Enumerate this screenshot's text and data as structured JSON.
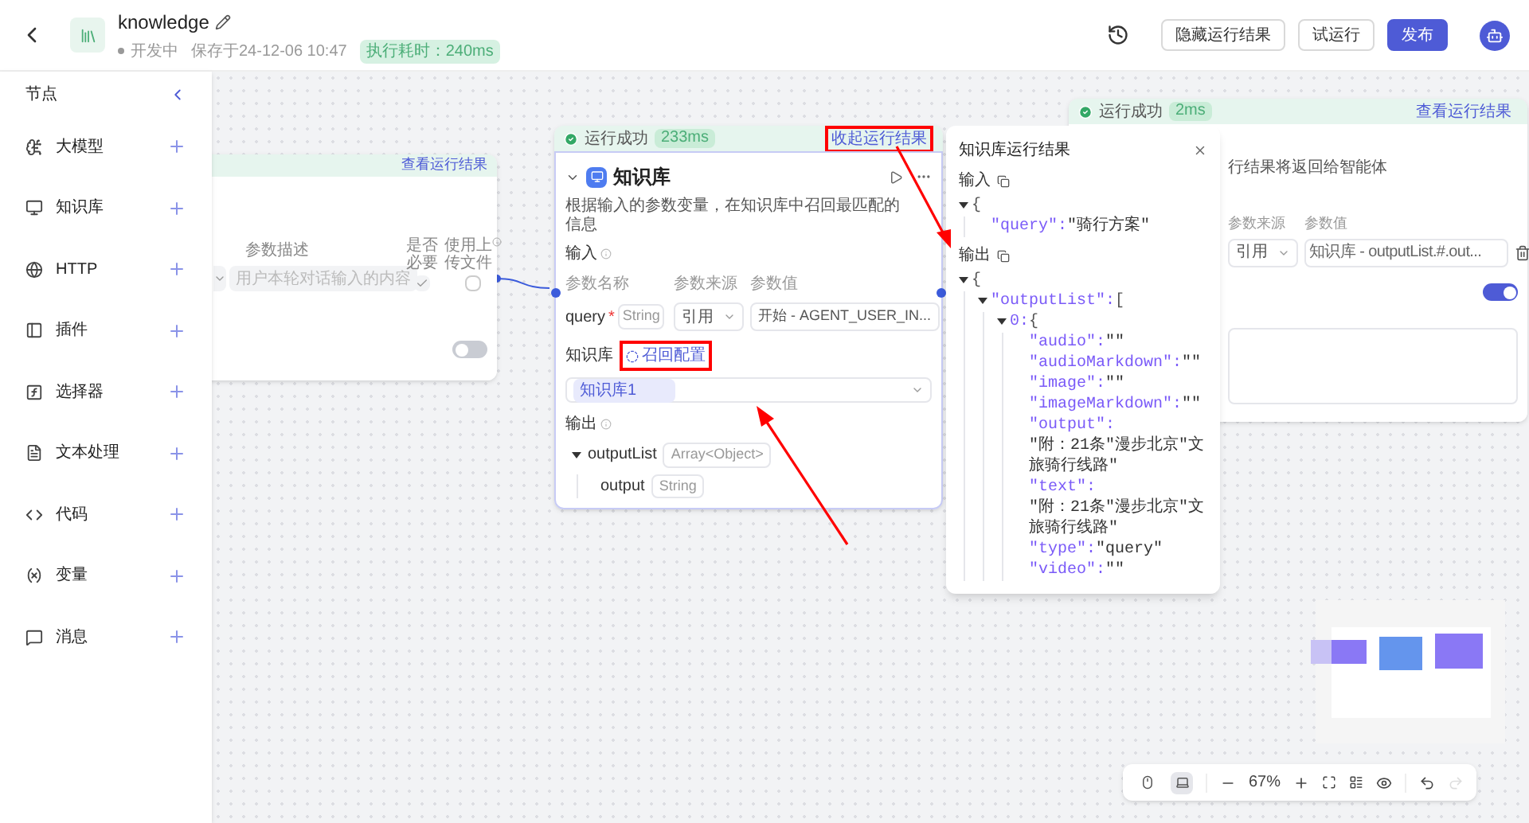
{
  "header": {
    "title": "knowledge",
    "status": "开发中",
    "saved": "保存于24-12-06 10:47",
    "run_time": "执行耗时：240ms",
    "buttons": [
      {
        "label": "隐藏运行结果",
        "kind": "secondary"
      },
      {
        "label": "试运行",
        "kind": "secondary"
      },
      {
        "label": "发布",
        "kind": "primary"
      }
    ]
  },
  "sidebar": {
    "title": "节点",
    "items": [
      {
        "label": "大模型"
      },
      {
        "label": "知识库"
      },
      {
        "label": "HTTP"
      },
      {
        "label": "插件"
      },
      {
        "label": "选择器"
      },
      {
        "label": "文本处理"
      },
      {
        "label": "代码"
      },
      {
        "label": "变量"
      },
      {
        "label": "消息"
      }
    ]
  },
  "start_node": {
    "result_link": "查看运行结果",
    "columns": [
      "参数描述",
      "是否必要",
      "使用上传文件"
    ],
    "placeholder": "用户本轮对话输入的内容",
    "required": true,
    "use_upload": false,
    "toggle_on": false
  },
  "knowledge_node": {
    "status": "运行成功",
    "duration": "233ms",
    "result_link": {
      "text": "收起运行结果",
      "highlighted": true
    },
    "title": "知识库",
    "description": "根据输入的参数变量，在知识库中召回最匹配的信息",
    "input_label": "输入",
    "columns": [
      "参数名称",
      "参数来源",
      "参数值"
    ],
    "param": {
      "name": "query",
      "required_mark": "*",
      "type": "String",
      "source": "引用",
      "value": "开始 - AGENT_USER_IN..."
    },
    "kb_label": "知识库",
    "recall_link": {
      "text": "召回配置",
      "highlighted": true
    },
    "kb_tag": "知识库1",
    "output_label": "输出",
    "outputs": [
      {
        "name": "outputList",
        "type": "Array<Object>",
        "expanded": true,
        "children": [
          {
            "name": "output",
            "type": "String"
          }
        ]
      }
    ]
  },
  "result_panel": {
    "title": "知识库运行结果",
    "sections": [
      {
        "label": "输入",
        "tree": [
          {
            "open": "{",
            "expanded": true,
            "children": [
              {
                "key": "\"query\":",
                "value": "\"骑行方案\""
              }
            ]
          }
        ]
      },
      {
        "label": "输出",
        "tree": [
          {
            "open": "{",
            "expanded": true,
            "children": [
              {
                "key": "\"outputList\":",
                "open": "[",
                "expanded": true,
                "children": [
                  {
                    "key": "0:",
                    "open": "{",
                    "expanded": true,
                    "children": [
                      {
                        "key": "\"audio\":",
                        "value": "\"\""
                      },
                      {
                        "key": "\"audioMarkdown\":",
                        "value": "\"\""
                      },
                      {
                        "key": "\"image\":",
                        "value": "\"\""
                      },
                      {
                        "key": "\"imageMarkdown\":",
                        "value": "\"\""
                      },
                      {
                        "key": "\"output\":",
                        "value": "\"附：21条\"漫步北京\"文旅骑行线路\""
                      },
                      {
                        "key": "\"text\":",
                        "value": "\"附：21条\"漫步北京\"文旅骑行线路\""
                      },
                      {
                        "key": "\"type\":",
                        "value": "\"query\""
                      },
                      {
                        "key": "\"video\":",
                        "value": "\"\""
                      }
                    ]
                  }
                ]
              }
            ]
          }
        ]
      }
    ]
  },
  "end_node": {
    "status": "运行成功",
    "duration": "2ms",
    "result_link": "查看运行结果",
    "description": "行结果将返回给智能体",
    "columns": [
      "参数来源",
      "参数值"
    ],
    "source": "引用",
    "value": "知识库 - outputList.#.out...",
    "stream_on": true
  },
  "toolbar": {
    "modes": [
      {
        "selected": false
      },
      {
        "selected": true
      }
    ],
    "zoom": "67%",
    "redo_disabled": true
  }
}
